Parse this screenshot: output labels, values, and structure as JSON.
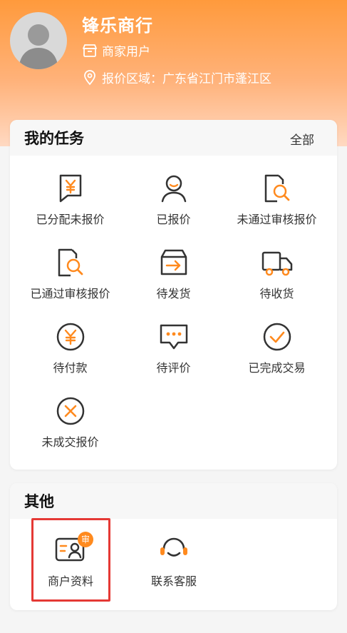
{
  "profile": {
    "name": "锋乐商行",
    "role": "商家用户",
    "region": "报价区域：广东省江门市蓬江区",
    "role_icon": "store-icon",
    "region_icon": "location-pin-icon"
  },
  "tasks": {
    "title": "我的任务",
    "all_link": "全部",
    "items": [
      {
        "label": "已分配未报价",
        "icon": "quote-yen-icon"
      },
      {
        "label": "已报价",
        "icon": "user-smile-icon"
      },
      {
        "label": "未通过审核报价",
        "icon": "review-search-icon"
      },
      {
        "label": "已通过审核报价",
        "icon": "review-search-icon"
      },
      {
        "label": "待发货",
        "icon": "ship-box-icon"
      },
      {
        "label": "待收货",
        "icon": "truck-icon"
      },
      {
        "label": "待付款",
        "icon": "yen-circle-icon"
      },
      {
        "label": "待评价",
        "icon": "chat-dots-icon"
      },
      {
        "label": "已完成交易",
        "icon": "check-circle-icon"
      },
      {
        "label": "未成交报价",
        "icon": "x-circle-icon"
      }
    ]
  },
  "other": {
    "title": "其他",
    "items": [
      {
        "label": "商户资料",
        "icon": "merchant-id-card-icon",
        "badge": "审"
      },
      {
        "label": "联系客服",
        "icon": "headset-icon"
      }
    ]
  },
  "colors": {
    "accent": "#ff8a1e",
    "icon_stroke": "#333333",
    "highlight": "#e53935"
  }
}
